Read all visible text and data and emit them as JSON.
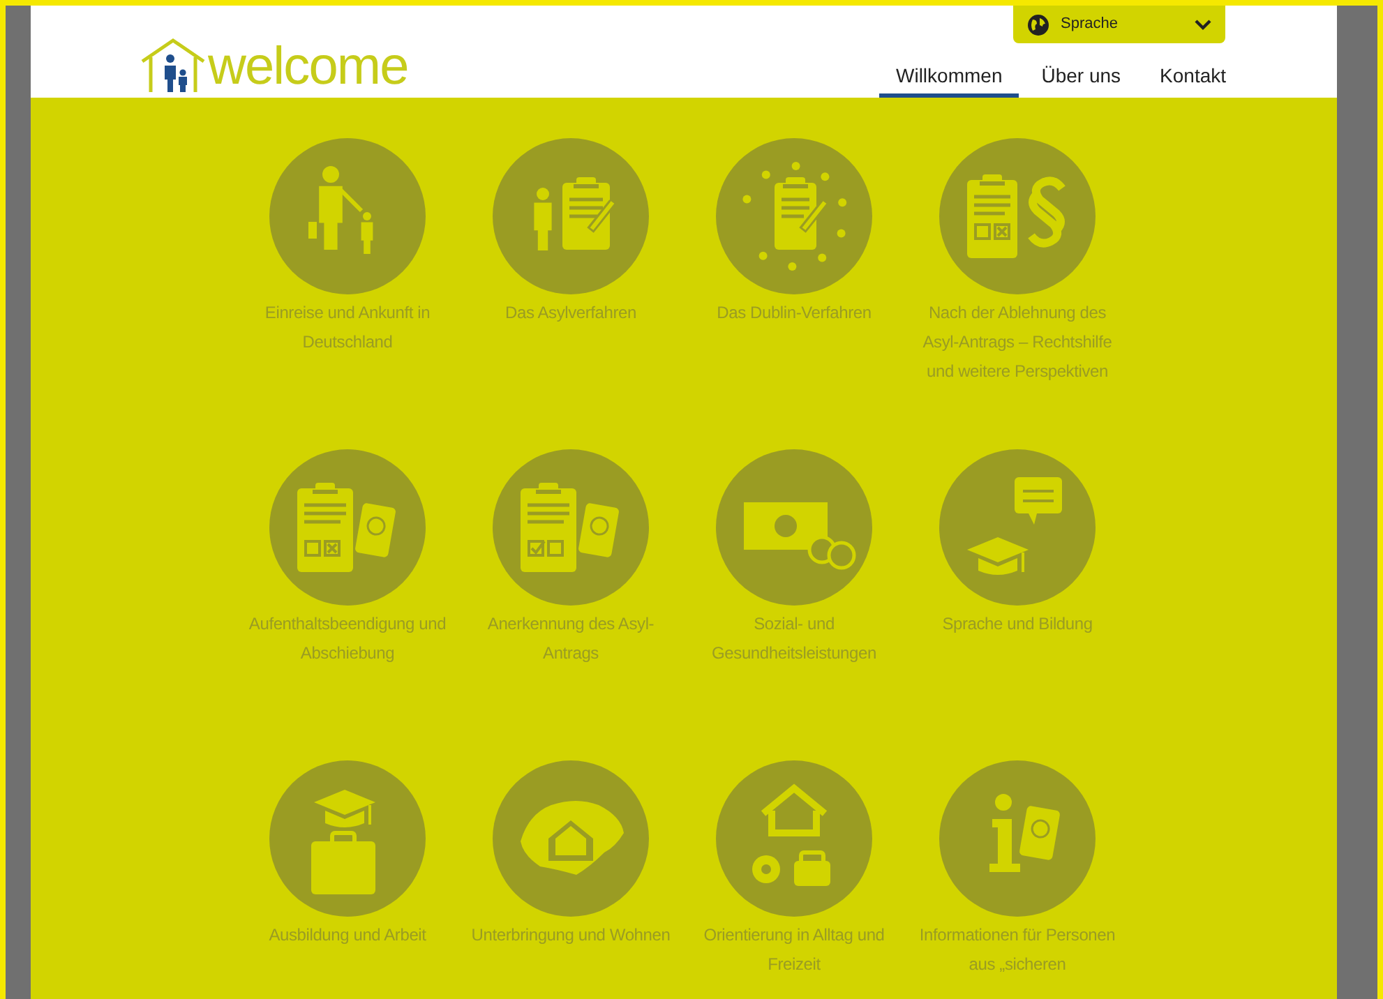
{
  "logo": {
    "text": "welcome"
  },
  "language_select": {
    "label": "Sprache"
  },
  "nav": [
    {
      "label": "Willkommen",
      "selected": true
    },
    {
      "label": "Über uns",
      "selected": false
    },
    {
      "label": "Kontakt",
      "selected": false
    }
  ],
  "topics": [
    {
      "label": "Einreise und Ankunft in Deutschland"
    },
    {
      "label": "Das Asylverfahren"
    },
    {
      "label": "Das Dublin-Verfahren"
    },
    {
      "label": "Nach der Ablehnung des Asyl-Antrags – Rechtshilfe und weitere Perspektiven"
    },
    {
      "label": "Aufenthaltsbeendigung und Abschiebung"
    },
    {
      "label": "Anerkennung des Asyl-Antrags"
    },
    {
      "label": "Sozial- und Gesundheitsleistungen"
    },
    {
      "label": "Sprache und Bildung"
    },
    {
      "label": "Ausbildung und Arbeit"
    },
    {
      "label": "Unterbringung und Wohnen"
    },
    {
      "label": "Orientierung in Alltag und Freizeit"
    },
    {
      "label": "Informationen für Personen aus „sicheren"
    }
  ]
}
